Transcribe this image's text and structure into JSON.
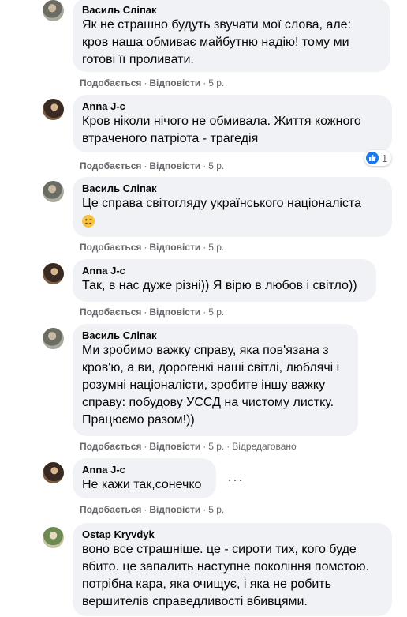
{
  "common": {
    "like": "Подобається",
    "reply": "Відповісти",
    "sep": "·"
  },
  "comments": [
    {
      "author": "Василь Сліпак",
      "text": "Як не страшно будуть звучати мої слова, але:\nкров наша обмиває майбутню надію! тому ми\nготові її проливати.",
      "time": "5 р."
    },
    {
      "author": "Anna J-c",
      "text": "Кров ніколи нічого не обмивала. Життя кожного\nвтраченого патріота - трагедія",
      "time": "5 р.",
      "reactions": "1"
    },
    {
      "author": "Василь Сліпак",
      "text": "Це справа світогляду українського націоналіста",
      "emoji": "wink-emoji",
      "time": "5 р."
    },
    {
      "author": "Anna J-c",
      "text": "Так, в нас дуже різні)) Я вірю в любов і світло))",
      "time": "5 р."
    },
    {
      "author": "Василь Сліпак",
      "text": "Ми зробимо важку справу, яка пов'язана з\nкров'ю, а ви, дорогенкі наші світлі, люблячі і\nрозумні націоналісти, зробите іншу важку\nсправу: побудову УССД на чистому листку.\nПрацюємо разом!))",
      "time": "5 р.",
      "edited": "Відредаговано"
    },
    {
      "author": "Anna J-c",
      "text": "Не кажи так,сонечко",
      "time": "5 р.",
      "more": "···"
    },
    {
      "author": "Ostap Kryvdyk",
      "text": "воно все страшніше. це - сироти тих, кого буде\nвбито. це запалить наступне покоління помстою.\nпотрібна кара, яка очищує, і яка не робить\nвершителів справедливості вбивцями."
    }
  ]
}
